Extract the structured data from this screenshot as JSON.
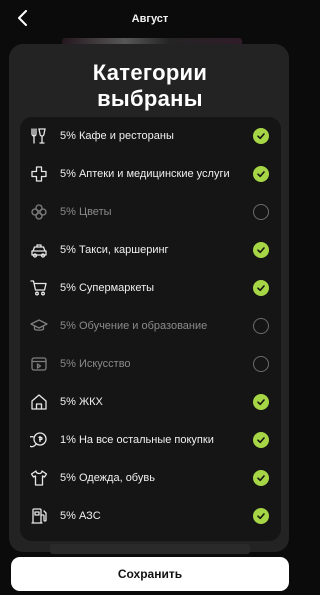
{
  "header": {
    "title": "Август"
  },
  "sheet": {
    "title_line1": "Категории",
    "title_line2": "выбраны"
  },
  "categories": [
    {
      "label": "5% Кафе и рестораны",
      "icon": "fork-glass-icon",
      "selected": true
    },
    {
      "label": "5% Аптеки и медицинские услуги",
      "icon": "medical-cross-icon",
      "selected": true
    },
    {
      "label": "5% Цветы",
      "icon": "flower-icon",
      "selected": false
    },
    {
      "label": "5% Такси, каршеринг",
      "icon": "car-icon",
      "selected": true
    },
    {
      "label": "5% Супермаркеты",
      "icon": "shopping-cart-icon",
      "selected": true
    },
    {
      "label": "5% Обучение и образование",
      "icon": "graduation-cap-icon",
      "selected": false
    },
    {
      "label": "5% Искусство",
      "icon": "art-ticket-icon",
      "selected": false
    },
    {
      "label": "5% ЖКХ",
      "icon": "house-icon",
      "selected": true
    },
    {
      "label": "1% На все остальные покупки",
      "icon": "coins-icon",
      "selected": true
    },
    {
      "label": "5% Одежда, обувь",
      "icon": "tshirt-icon",
      "selected": true
    },
    {
      "label": "5% АЗС",
      "icon": "fuel-pump-icon",
      "selected": true
    }
  ],
  "footer": {
    "save_label": "Сохранить"
  },
  "colors": {
    "accent": "#a6d645",
    "sheet_bg": "#232323",
    "list_bg": "#151515"
  }
}
